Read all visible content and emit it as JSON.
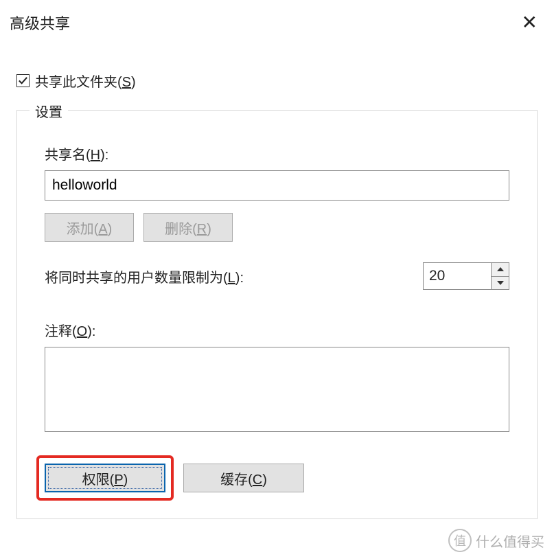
{
  "dialog": {
    "title": "高级共享"
  },
  "share_checkbox": {
    "label_pre": "共享此文件夹(",
    "hotkey": "S",
    "label_post": ")",
    "checked": true
  },
  "groupbox": {
    "title": "设置",
    "share_name": {
      "label_pre": "共享名(",
      "hotkey": "H",
      "label_post": "):",
      "value": "helloworld"
    },
    "add_btn": {
      "pre": "添加(",
      "hotkey": "A",
      "post": ")"
    },
    "remove_btn": {
      "pre": "删除(",
      "hotkey": "R",
      "post": ")"
    },
    "limit": {
      "label_pre": "将同时共享的用户数量限制为(",
      "hotkey": "L",
      "label_post": "):",
      "value": "20"
    },
    "comment": {
      "label_pre": "注释(",
      "hotkey": "O",
      "label_post": "):",
      "value": ""
    },
    "permissions_btn": {
      "pre": "权限(",
      "hotkey": "P",
      "post": ")"
    },
    "cache_btn": {
      "pre": "缓存(",
      "hotkey": "C",
      "post": ")"
    }
  },
  "watermark": {
    "badge": "值",
    "text": "什么值得买"
  }
}
